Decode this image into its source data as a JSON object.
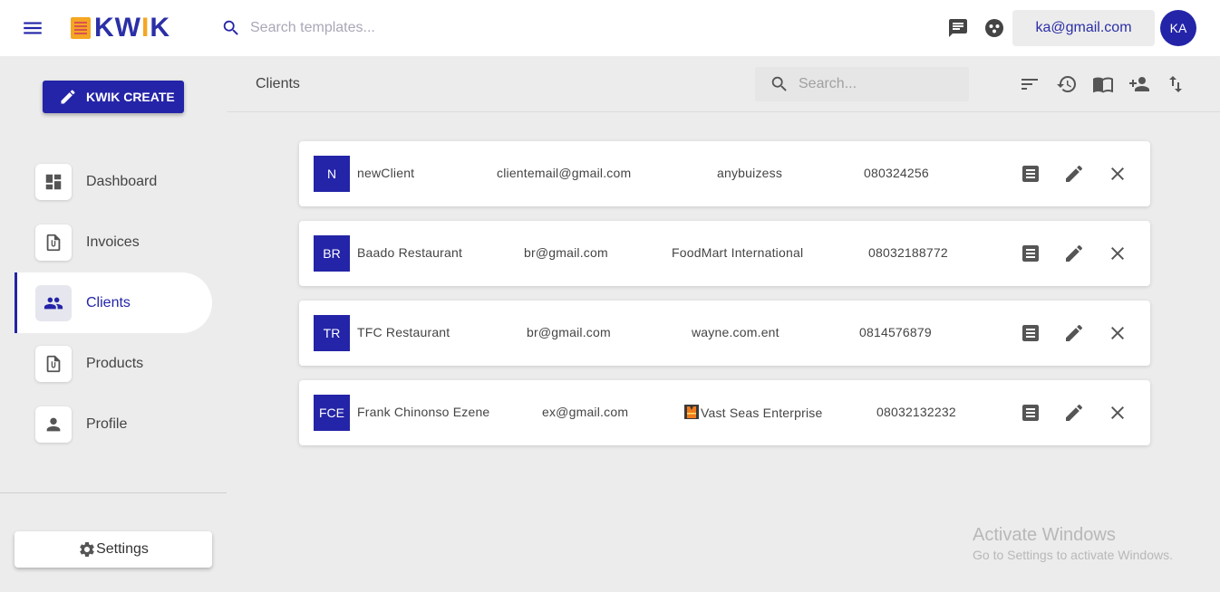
{
  "header": {
    "logo_text": "KWIK",
    "search_placeholder": "Search templates...",
    "user_email": "ka@gmail.com",
    "user_initials": "KA"
  },
  "sidebar": {
    "create_label": "KWIK CREATE",
    "items": [
      {
        "label": "Dashboard",
        "icon": "dashboard-icon"
      },
      {
        "label": "Invoices",
        "icon": "invoice-icon"
      },
      {
        "label": "Clients",
        "icon": "people-icon",
        "active": true
      },
      {
        "label": "Products",
        "icon": "product-icon"
      },
      {
        "label": "Profile",
        "icon": "person-icon"
      }
    ],
    "settings_label": "Settings"
  },
  "main": {
    "title": "Clients",
    "search_placeholder": "Search...",
    "toolbar_icons": [
      "sort-icon",
      "history-icon",
      "book-icon",
      "add-person-icon",
      "swap-vertical-icon"
    ]
  },
  "clients": [
    {
      "initials": "N",
      "name": "newClient",
      "email": "clientemail@gmail.com",
      "business": "anybuizess",
      "phone": "080324256"
    },
    {
      "initials": "BR",
      "name": "Baado Restaurant",
      "email": "br@gmail.com",
      "business": "FoodMart International",
      "phone": "08032188772"
    },
    {
      "initials": "TR",
      "name": "TFC Restaurant",
      "email": "br@gmail.com",
      "business": "wayne.com.ent",
      "phone": "0814576879"
    },
    {
      "initials": "FCE",
      "name": "Frank Chinonso Ezene",
      "email": "ex@gmail.com",
      "business": "Vast Seas Enterprise",
      "phone": "08032132232"
    }
  ],
  "watermark": {
    "line1": "Activate Windows",
    "line2": "Go to Settings to activate Windows."
  },
  "colors": {
    "brand": "#2424a8",
    "accent": "#f5a623",
    "background": "#ececec"
  }
}
